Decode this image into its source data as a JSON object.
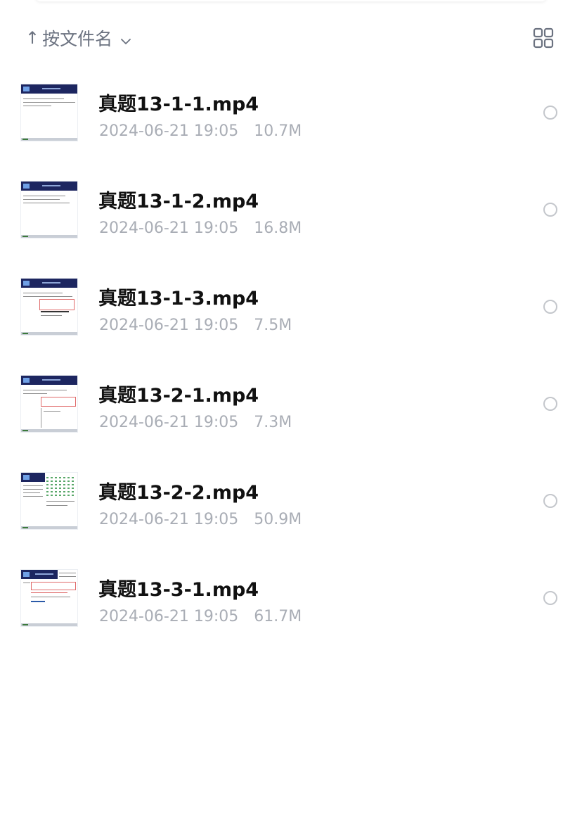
{
  "sort": {
    "arrow": "↑",
    "label": "按文件名",
    "chevron_icon": "chevron-down-icon"
  },
  "view_toggle": {
    "icon": "grid-view-icon"
  },
  "files": [
    {
      "name": "真题13-1-1.mp4",
      "date": "2024-06-21 19:05",
      "size": "10.7M",
      "thumbnail_icon": "video-thumbnail"
    },
    {
      "name": "真题13-1-2.mp4",
      "date": "2024-06-21 19:05",
      "size": "16.8M",
      "thumbnail_icon": "video-thumbnail"
    },
    {
      "name": "真题13-1-3.mp4",
      "date": "2024-06-21 19:05",
      "size": "7.5M",
      "thumbnail_icon": "video-thumbnail"
    },
    {
      "name": "真题13-2-1.mp4",
      "date": "2024-06-21 19:05",
      "size": "7.3M",
      "thumbnail_icon": "video-thumbnail"
    },
    {
      "name": "真题13-2-2.mp4",
      "date": "2024-06-21 19:05",
      "size": "50.9M",
      "thumbnail_icon": "video-thumbnail"
    },
    {
      "name": "真题13-3-1.mp4",
      "date": "2024-06-21 19:05",
      "size": "61.7M",
      "thumbnail_icon": "video-thumbnail"
    }
  ],
  "colors": {
    "title_text": "#111111",
    "meta_text": "#a9adb5",
    "sort_text": "#6b7280",
    "thumb_header": "#1d2660"
  }
}
